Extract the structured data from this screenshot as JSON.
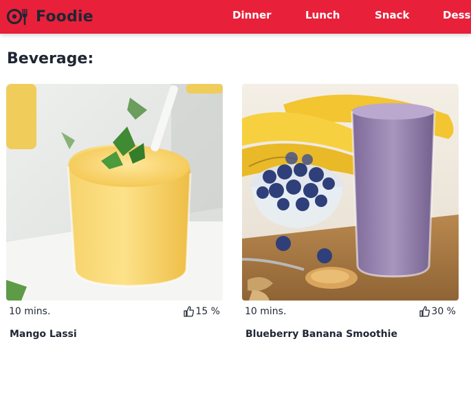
{
  "brand": {
    "name": "Foodie",
    "icon": "plate-fork-icon"
  },
  "nav": {
    "items": [
      "Dinner",
      "Lunch",
      "Snack",
      "Dessert"
    ]
  },
  "section": {
    "title": "Beverage:"
  },
  "cards": [
    {
      "title": "Mango Lassi",
      "time": "10 mins.",
      "rating": "15 %",
      "image": "mango-lassi-photo"
    },
    {
      "title": "Blueberry Banana Smoothie",
      "time": "10 mins.",
      "rating": "30 %",
      "image": "blueberry-banana-smoothie-photo"
    }
  ],
  "colors": {
    "navbar": "#e8203a",
    "text": "#1f2633",
    "nav_text": "#ffffff"
  }
}
